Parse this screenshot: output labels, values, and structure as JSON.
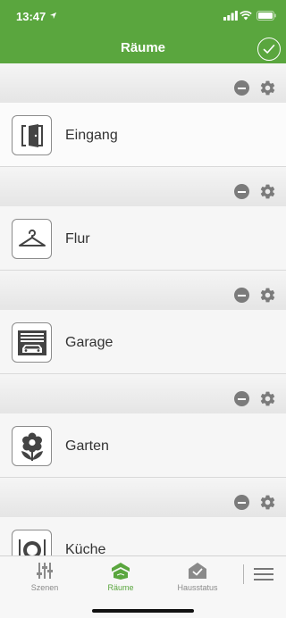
{
  "status_bar": {
    "time": "13:47"
  },
  "header": {
    "title": "Räume"
  },
  "rooms": [
    {
      "name": "Eingang",
      "icon": "door-icon"
    },
    {
      "name": "Flur",
      "icon": "hanger-icon"
    },
    {
      "name": "Garage",
      "icon": "garage-icon"
    },
    {
      "name": "Garten",
      "icon": "flower-icon"
    },
    {
      "name": "Küche",
      "icon": "dining-icon"
    }
  ],
  "tabbar": {
    "tabs": [
      {
        "label": "Szenen",
        "icon": "sliders-icon",
        "selected": false
      },
      {
        "label": "Räume",
        "icon": "house-icon",
        "selected": true
      },
      {
        "label": "Hausstatus",
        "icon": "house-check-icon",
        "selected": false
      }
    ],
    "menu_icon": "hamburger-menu-icon"
  },
  "colors": {
    "accent": "#5aa63e",
    "icon_gray": "#7b7b7b"
  }
}
